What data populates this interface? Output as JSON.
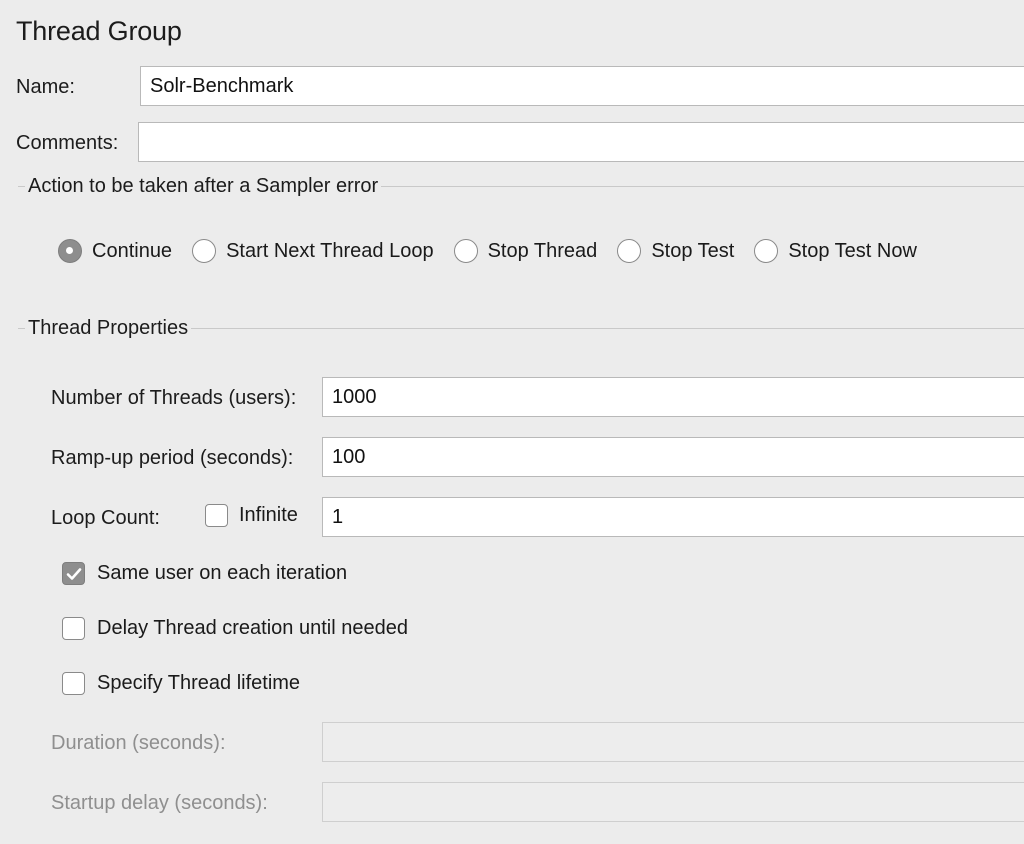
{
  "panel": {
    "title": "Thread Group"
  },
  "name_field": {
    "label": "Name:",
    "value": "Solr-Benchmark"
  },
  "comments_field": {
    "label": "Comments:",
    "value": ""
  },
  "sampler_error": {
    "title": "Action to be taken after a Sampler error",
    "options": [
      "Continue",
      "Start Next Thread Loop",
      "Stop Thread",
      "Stop Test",
      "Stop Test Now"
    ],
    "selected": "Continue"
  },
  "thread_properties": {
    "title": "Thread Properties",
    "num_threads": {
      "label": "Number of Threads (users):",
      "value": "1000"
    },
    "ramp_up": {
      "label": "Ramp-up period (seconds):",
      "value": "100"
    },
    "loop_count": {
      "label": "Loop Count:",
      "infinite_label": "Infinite",
      "infinite_checked": false,
      "value": "1"
    },
    "same_user": {
      "label": "Same user on each iteration",
      "checked": true
    },
    "delay_creation": {
      "label": "Delay Thread creation until needed",
      "checked": false
    },
    "specify_lifetime": {
      "label": "Specify Thread lifetime",
      "checked": false
    },
    "duration": {
      "label": "Duration (seconds):",
      "value": ""
    },
    "startup_delay": {
      "label": "Startup delay (seconds):",
      "value": ""
    }
  },
  "colors": {
    "background": "#ececec",
    "field": "#ffffff",
    "selected_control": "#8e8e8e"
  }
}
